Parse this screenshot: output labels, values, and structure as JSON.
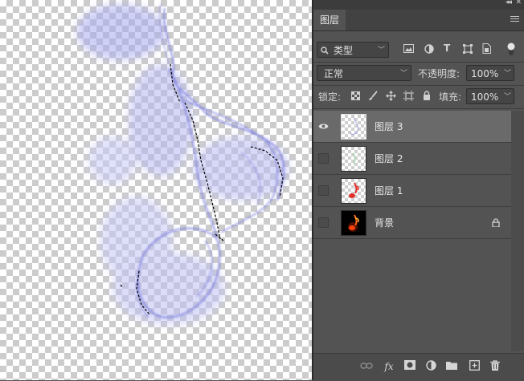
{
  "panel": {
    "tab_label": "图层",
    "filter": {
      "kind_label": "类型"
    },
    "blend_mode": "正常",
    "opacity_label": "不透明度:",
    "opacity_value": "100%",
    "lock_label": "锁定:",
    "fill_label": "填充:",
    "fill_value": "100%"
  },
  "layers": [
    {
      "name": "图层 3",
      "visible": true,
      "selected": true,
      "thumb": "swirl"
    },
    {
      "name": "图层 2",
      "visible": false,
      "selected": false,
      "thumb": "green"
    },
    {
      "name": "图层 1",
      "visible": false,
      "selected": false,
      "thumb": "red-note"
    },
    {
      "name": "背景",
      "visible": false,
      "selected": false,
      "thumb": "dark-note",
      "locked": true
    }
  ],
  "colors": {
    "accent_stroke": "#7d7fe0",
    "panel_bg": "#535353",
    "selected_row": "#6a6a6a"
  }
}
